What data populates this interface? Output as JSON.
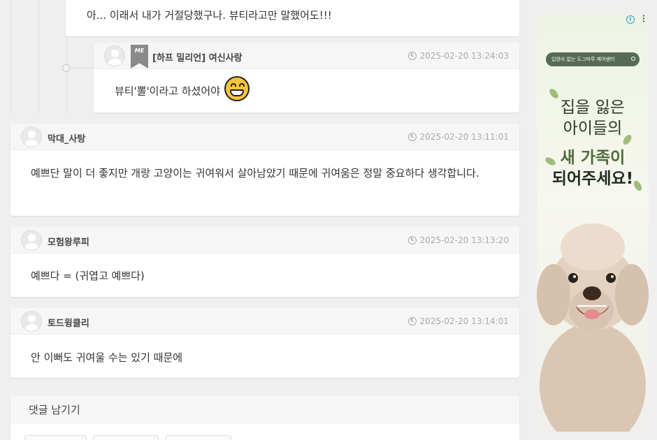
{
  "comments": [
    {
      "text": "아... 이래서 내가 거절당했구나. 뷰티라고만 말했어도!!!"
    },
    {
      "badge": "ME",
      "author": "[하프 밀리언] 여신사랑",
      "time": "2025-02-20 13:24:03",
      "text": "뷰티'뽈'이라고 하셨어야",
      "emoji": "grinning-face-icon"
    },
    {
      "author": "막대_사탕",
      "time": "2025-02-20 13:11:01",
      "text": "예쁘단 말이 더 좋지만 개랑 고양이는 귀여워서 살아남았기 때문에 귀여움은 정말 중요하다 생각합니다."
    },
    {
      "author": "모험왕루피",
      "time": "2025-02-20 13:13:20",
      "text": "예쁘다 = (귀엽고 예쁘다)"
    },
    {
      "author": "토드윙클리",
      "time": "2025-02-20 13:14:01",
      "text": "안 이뻐도 귀여울 수는 있기 때문에"
    }
  ],
  "reply_form": {
    "title": "댓글 남기기"
  },
  "ad": {
    "search_text": "입양사 없는 도그마루 케어센터",
    "headline_1": "집을 잃은",
    "headline_2": "아이들의",
    "headline_3": "새 가족이",
    "headline_4": "되어주세요!",
    "info_icon": "info-icon",
    "menu_icon": "more-vertical-icon",
    "colors": {
      "accent_green": "#556b54",
      "headline_dark": "#2d3a2a"
    }
  }
}
